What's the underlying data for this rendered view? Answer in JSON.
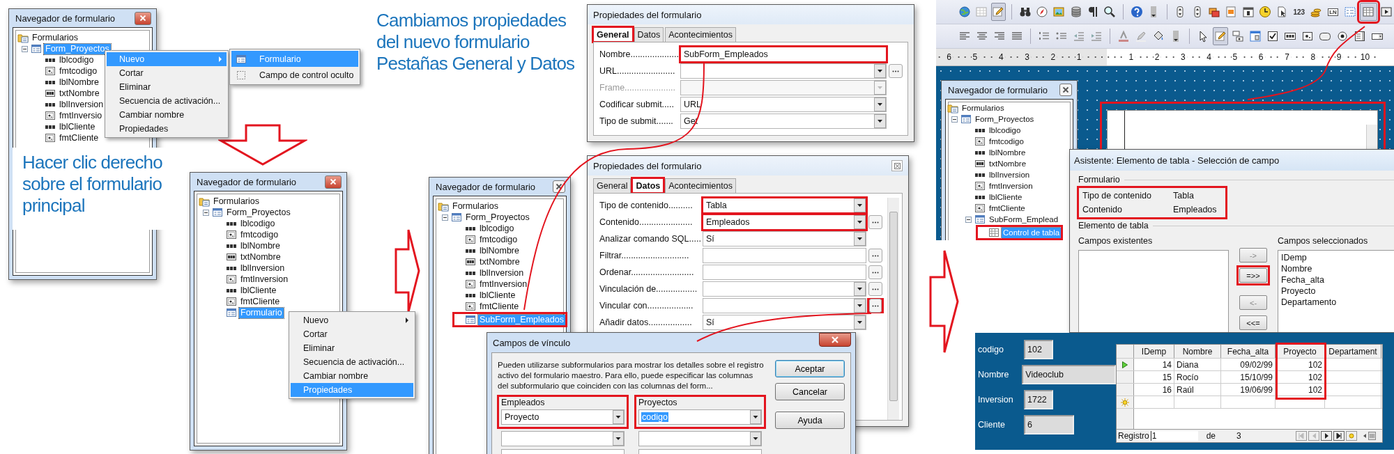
{
  "callouts": [
    {
      "lines": [
        "Hacer clic derecho",
        "sobre el formulario",
        "principal"
      ]
    },
    {
      "lines": [
        "Cambiamos propiedades",
        "del nuevo formulario",
        "Pestañas General y Datos"
      ]
    }
  ],
  "navigators": [
    {
      "title": "Navegador de formulario",
      "highlight_selected": false,
      "tree": [
        {
          "label": "Formularios",
          "kind": "folder",
          "selected": false,
          "children": [
            {
              "label": "Form_Proyectos",
              "kind": "form",
              "expanded": true,
              "selected": true,
              "children": [
                {
                  "label": "lblcodigo",
                  "kind": "label",
                  "selected": false
                },
                {
                  "label": "fmtcodigo",
                  "kind": "formatted",
                  "selected": false
                },
                {
                  "label": "lblNombre",
                  "kind": "label",
                  "selected": false
                },
                {
                  "label": "txtNombre",
                  "kind": "text",
                  "selected": false
                },
                {
                  "label": "lblInversion",
                  "kind": "label",
                  "selected": false
                },
                {
                  "label": "fmtInversio",
                  "kind": "formatted",
                  "selected": false
                },
                {
                  "label": "lblCliente",
                  "kind": "label",
                  "selected": false
                },
                {
                  "label": "fmtCliente",
                  "kind": "formatted",
                  "selected": false
                }
              ]
            }
          ]
        }
      ]
    },
    {
      "title": "Navegador de formulario",
      "highlight_selected": false,
      "tree": [
        {
          "label": "Formularios",
          "kind": "folder",
          "selected": false,
          "children": [
            {
              "label": "Form_Proyectos",
              "kind": "form",
              "expanded": true,
              "selected": false,
              "children": [
                {
                  "label": "lblcodigo",
                  "kind": "label",
                  "selected": false
                },
                {
                  "label": "fmtcodigo",
                  "kind": "formatted",
                  "selected": false
                },
                {
                  "label": "lblNombre",
                  "kind": "label",
                  "selected": false
                },
                {
                  "label": "txtNombre",
                  "kind": "text",
                  "selected": false
                },
                {
                  "label": "lblInversion",
                  "kind": "label",
                  "selected": false
                },
                {
                  "label": "fmtInversion",
                  "kind": "formatted",
                  "selected": false
                },
                {
                  "label": "lblCliente",
                  "kind": "label",
                  "selected": false
                },
                {
                  "label": "fmtCliente",
                  "kind": "formatted",
                  "selected": false
                },
                {
                  "label": "Formulario",
                  "kind": "form",
                  "selected": true
                }
              ]
            }
          ]
        }
      ]
    },
    {
      "title": "Navegador de formulario",
      "highlight_selected": true,
      "tree": [
        {
          "label": "Formularios",
          "kind": "folder",
          "selected": false,
          "children": [
            {
              "label": "Form_Proyectos",
              "kind": "form",
              "expanded": true,
              "selected": false,
              "children": [
                {
                  "label": "lblcodigo",
                  "kind": "label",
                  "selected": false
                },
                {
                  "label": "fmtcodigo",
                  "kind": "formatted",
                  "selected": false
                },
                {
                  "label": "lblNombre",
                  "kind": "label",
                  "selected": false
                },
                {
                  "label": "txtNombre",
                  "kind": "text",
                  "selected": false
                },
                {
                  "label": "lblInversion",
                  "kind": "label",
                  "selected": false
                },
                {
                  "label": "fmtInversion",
                  "kind": "formatted",
                  "selected": false
                },
                {
                  "label": "lblCliente",
                  "kind": "label",
                  "selected": false
                },
                {
                  "label": "fmtCliente",
                  "kind": "formatted",
                  "selected": false
                },
                {
                  "label": "SubForm_Empleados",
                  "kind": "form",
                  "selected": true
                }
              ]
            }
          ]
        }
      ]
    },
    {
      "title": "Navegador de formulario",
      "highlight_selected": true,
      "tree": [
        {
          "label": "Formularios",
          "kind": "folder",
          "selected": false,
          "children": [
            {
              "label": "Form_Proyectos",
              "kind": "form",
              "expanded": true,
              "selected": false,
              "children": [
                {
                  "label": "lblcodigo",
                  "kind": "label",
                  "selected": false
                },
                {
                  "label": "fmtcodigo",
                  "kind": "formatted",
                  "selected": false
                },
                {
                  "label": "lblNombre",
                  "kind": "label",
                  "selected": false
                },
                {
                  "label": "txtNombre",
                  "kind": "text",
                  "selected": false
                },
                {
                  "label": "lblInversion",
                  "kind": "label",
                  "selected": false
                },
                {
                  "label": "fmtInversion",
                  "kind": "formatted",
                  "selected": false
                },
                {
                  "label": "lblCliente",
                  "kind": "label",
                  "selected": false
                },
                {
                  "label": "fmtCliente",
                  "kind": "formatted",
                  "selected": false
                },
                {
                  "label": "SubForm_Emplead",
                  "kind": "form",
                  "expanded": true,
                  "selected": false,
                  "children": [
                    {
                      "label": "Control de tabla",
                      "kind": "grid",
                      "selected": true
                    }
                  ]
                }
              ]
            }
          ]
        }
      ]
    }
  ],
  "context_menus": [
    {
      "items": [
        {
          "label": "Nuevo",
          "selected": true,
          "submenu": true
        },
        {
          "label": "Cortar",
          "selected": false,
          "submenu": false
        },
        {
          "label": "Eliminar",
          "selected": false,
          "submenu": false
        },
        {
          "label": "Secuencia de activación...",
          "selected": false,
          "submenu": false
        },
        {
          "label": "Cambiar nombre",
          "selected": false,
          "submenu": false
        },
        {
          "label": "Propiedades",
          "selected": false,
          "submenu": false
        }
      ],
      "submenu": [
        {
          "label": "Formulario",
          "kind": "form",
          "selected": true
        },
        {
          "label": "Campo de control oculto",
          "kind": "hidden",
          "selected": false
        }
      ]
    },
    {
      "items": [
        {
          "label": "Nuevo",
          "selected": false,
          "submenu": true
        },
        {
          "label": "Cortar",
          "selected": false,
          "submenu": false
        },
        {
          "label": "Eliminar",
          "selected": false,
          "submenu": false
        },
        {
          "label": "Secuencia de activación...",
          "selected": false,
          "submenu": false
        },
        {
          "label": "Cambiar nombre",
          "selected": false,
          "submenu": false
        },
        {
          "label": "Propiedades",
          "selected": true,
          "submenu": false
        }
      ]
    }
  ],
  "property_dialogs": [
    {
      "title": "Propiedades del formulario",
      "close_button": false,
      "highlight_selected_tab": true,
      "tabs": [
        {
          "label": "General",
          "selected": true
        },
        {
          "label": "Datos",
          "selected": false
        },
        {
          "label": "Acontecimientos",
          "selected": false
        }
      ],
      "rows": [
        {
          "label": "Nombre....................",
          "kind": "text",
          "value": "SubForm_Empleados",
          "highlighted": true,
          "browse": false,
          "browse_highlighted": false
        },
        {
          "label": "URL........................",
          "kind": "combo",
          "highlighted": false,
          "browse": true,
          "browse_highlighted": false
        },
        {
          "label": "Frame.....................",
          "kind": "disabled",
          "highlighted": false,
          "browse": false,
          "browse_highlighted": false
        },
        {
          "label": "Codificar submit.....",
          "kind": "combo",
          "value": "URL",
          "highlighted": false,
          "browse": false,
          "browse_highlighted": false
        },
        {
          "label": "Tipo de submit.......",
          "kind": "combo",
          "value": "Get",
          "highlighted": false,
          "browse": false,
          "browse_highlighted": false
        }
      ]
    },
    {
      "title": "Propiedades del formulario",
      "close_button": true,
      "highlight_selected_tab": true,
      "tabs": [
        {
          "label": "General",
          "selected": false
        },
        {
          "label": "Datos",
          "selected": true
        },
        {
          "label": "Acontecimientos",
          "selected": false
        }
      ],
      "rows": [
        {
          "label": "Tipo de contenido..........",
          "kind": "combo",
          "value": "Tabla",
          "highlighted": true,
          "browse": false,
          "browse_highlighted": false
        },
        {
          "label": "Contenido......................",
          "kind": "combo",
          "value": "Empleados",
          "highlighted": true,
          "browse": true,
          "browse_highlighted": false
        },
        {
          "label": "Analizar comando SQL.....",
          "kind": "combo",
          "value": "Sí",
          "highlighted": false,
          "browse": false,
          "browse_highlighted": false
        },
        {
          "label": "Filtrar............................",
          "kind": "text",
          "highlighted": false,
          "browse": true,
          "browse_highlighted": false
        },
        {
          "label": "Ordenar..........................",
          "kind": "text",
          "highlighted": false,
          "browse": true,
          "browse_highlighted": false
        },
        {
          "label": "Vinculación de.................",
          "kind": "combo",
          "highlighted": false,
          "browse": true,
          "browse_highlighted": false
        },
        {
          "label": "Vincular con...................",
          "kind": "combo",
          "highlighted": false,
          "browse": true,
          "browse_highlighted": true
        },
        {
          "label": "Añadir datos..................",
          "kind": "combo",
          "value": "Sí",
          "highlighted": false,
          "browse": false,
          "browse_highlighted": false
        }
      ]
    }
  ],
  "link_dialog": {
    "title": "Campos de vínculo",
    "text": "Pueden utilizarse subformularios para mostrar los detalles sobre el registro activo del formulario maestro. Para ello, puede especificar las columnas del subformulario que coinciden con las columnas del form...",
    "groups": [
      {
        "label": "Empleados",
        "highlighted": true,
        "value": "Proyecto",
        "value_selected": false
      },
      {
        "label": "Proyectos",
        "highlighted": true,
        "value": "codigo",
        "value_selected": true
      }
    ],
    "buttons": [
      {
        "label": "Aceptar",
        "default": true
      },
      {
        "label": "Cancelar",
        "default": false
      },
      {
        "label": "Ayuda",
        "default": false
      }
    ]
  },
  "toolbars": [
    {
      "groups": [
        {
          "items": [
            {
              "kind": "globe",
              "pressed": false,
              "highlighted": false
            },
            {
              "kind": "grid",
              "pressed": false,
              "highlighted": false
            },
            {
              "kind": "pencil",
              "pressed": true,
              "highlighted": false
            }
          ]
        },
        {
          "items": [
            {
              "kind": "binoculars",
              "pressed": false,
              "highlighted": false
            },
            {
              "kind": "compass",
              "pressed": false,
              "highlighted": false
            },
            {
              "kind": "picture",
              "pressed": false,
              "highlighted": false
            },
            {
              "kind": "database",
              "pressed": false,
              "highlighted": false
            },
            {
              "kind": "pilcrow",
              "pressed": false,
              "highlighted": false
            },
            {
              "kind": "magnifier",
              "pressed": false,
              "highlighted": false
            }
          ]
        },
        {
          "items": [
            {
              "kind": "help",
              "pressed": false,
              "highlighted": false
            },
            {
              "kind": "overflow",
              "pressed": false,
              "highlighted": false
            }
          ]
        },
        {
          "items": [
            {
              "kind": "spin",
              "pressed": false,
              "highlighted": false
            },
            {
              "kind": "spin",
              "pressed": false,
              "highlighted": false
            },
            {
              "kind": "group-box",
              "pressed": false,
              "highlighted": false
            },
            {
              "kind": "image-button",
              "pressed": false,
              "highlighted": false
            },
            {
              "kind": "calendar",
              "pressed": false,
              "highlighted": false
            },
            {
              "kind": "clock",
              "pressed": false,
              "highlighted": false
            },
            {
              "kind": "file-pointer",
              "pressed": false,
              "highlighted": false
            },
            {
              "kind": "numeric",
              "text": "123",
              "pressed": false,
              "highlighted": false
            },
            {
              "kind": "coins",
              "pressed": false,
              "highlighted": false
            },
            {
              "kind": "pattern",
              "text": "LN",
              "pressed": false,
              "highlighted": false
            },
            {
              "kind": "form-nav",
              "pressed": false,
              "highlighted": false
            },
            {
              "kind": "table",
              "pressed": true,
              "highlighted": true
            },
            {
              "kind": "nav-bar",
              "pressed": false,
              "highlighted": false
            }
          ]
        }
      ]
    },
    {
      "groups": [
        {
          "items": [
            {
              "kind": "align-left",
              "pressed": false,
              "highlighted": false
            },
            {
              "kind": "align-center",
              "pressed": false,
              "highlighted": false
            },
            {
              "kind": "align-right",
              "pressed": false,
              "highlighted": false
            },
            {
              "kind": "align-justify",
              "pressed": false,
              "highlighted": false
            }
          ]
        },
        {
          "items": [
            {
              "kind": "numbered-list",
              "pressed": false,
              "highlighted": false
            },
            {
              "kind": "bullet-list",
              "pressed": false,
              "highlighted": false
            },
            {
              "kind": "outdent",
              "pressed": false,
              "highlighted": false
            },
            {
              "kind": "indent",
              "pressed": false,
              "highlighted": false
            }
          ]
        },
        {
          "items": [
            {
              "kind": "font-color",
              "pressed": false,
              "highlighted": false
            },
            {
              "kind": "highlighter",
              "pressed": false,
              "highlighted": false
            },
            {
              "kind": "paint-bucket",
              "pressed": false,
              "highlighted": false
            },
            {
              "kind": "overflow",
              "pressed": false,
              "highlighted": false
            }
          ]
        },
        {
          "items": [
            {
              "kind": "pointer",
              "pressed": false,
              "highlighted": false
            },
            {
              "kind": "pencil",
              "pressed": true,
              "highlighted": false
            },
            {
              "kind": "control-props",
              "pressed": false,
              "highlighted": false
            },
            {
              "kind": "form-props",
              "pressed": false,
              "highlighted": false
            },
            {
              "kind": "checkbox",
              "pressed": false,
              "highlighted": false
            },
            {
              "kind": "text-box",
              "pressed": false,
              "highlighted": false
            },
            {
              "kind": "formatted-box",
              "pressed": false,
              "highlighted": false
            },
            {
              "kind": "push-button",
              "pressed": false,
              "highlighted": false
            },
            {
              "kind": "radio",
              "pressed": false,
              "highlighted": false
            },
            {
              "kind": "list-box",
              "pressed": false,
              "highlighted": false
            },
            {
              "kind": "combo-box",
              "pressed": false,
              "highlighted": false
            }
          ]
        }
      ]
    }
  ],
  "ruler": {
    "labels": [
      "6",
      "5",
      "4",
      "3",
      "2",
      "1",
      "1",
      "2",
      "3",
      "4",
      "5",
      "6",
      "7",
      "8",
      "9",
      "10"
    ]
  },
  "wizard": {
    "title": "Asistente: Elemento de tabla - Selección de campo",
    "form_group": "Formulario",
    "info_highlighted": true,
    "info": [
      {
        "name": "Tipo de contenido",
        "value": "Tabla"
      },
      {
        "name": "Contenido",
        "value": "Empleados"
      }
    ],
    "table_group": "Elemento de tabla",
    "existing_label": "Campos existentes",
    "selected_label": "Campos seleccionados",
    "selected_fields": [
      "IDemp",
      "Nombre",
      "Fecha_alta",
      "Proyecto",
      "Departamento"
    ],
    "move_buttons": [
      {
        "label": "->",
        "disabled": true,
        "highlighted": false
      },
      {
        "label": "=>>",
        "disabled": false,
        "highlighted": true
      },
      {
        "label": "<-",
        "disabled": true,
        "highlighted": false
      },
      {
        "label": "<<=",
        "disabled": false,
        "highlighted": false
      }
    ]
  },
  "form_view": {
    "fields": [
      {
        "label": "codigo",
        "value": "102"
      },
      {
        "label": "Nombre",
        "value": "Videoclub"
      },
      {
        "label": "Inversion",
        "value": "1722"
      },
      {
        "label": "Cliente",
        "value": "6"
      }
    ],
    "grid": {
      "columns": [
        {
          "label": "IDemp",
          "kind": "number",
          "highlighted": false
        },
        {
          "label": "Nombre",
          "kind": "text",
          "highlighted": false
        },
        {
          "label": "Fecha_alta",
          "kind": "number",
          "highlighted": false
        },
        {
          "label": "Proyecto",
          "kind": "number",
          "highlighted": true
        },
        {
          "label": "Departament",
          "kind": "text",
          "highlighted": false
        }
      ],
      "rows": [
        {
          "current": true,
          "cells": [
            "14",
            "Diana",
            "09/02/99",
            "102"
          ]
        },
        {
          "current": false,
          "cells": [
            "15",
            "Rocío",
            "15/10/99",
            "102"
          ]
        },
        {
          "current": false,
          "cells": [
            "16",
            "Raúl",
            "19/06/99",
            "102"
          ]
        }
      ],
      "new_row": true
    },
    "navigation": {
      "label": "Registro",
      "record": "1",
      "of": "de",
      "total": "3"
    }
  }
}
